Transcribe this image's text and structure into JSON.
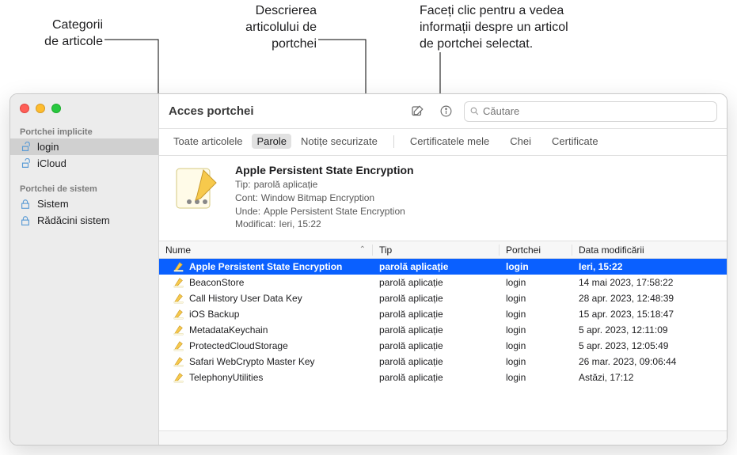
{
  "callouts": {
    "categories": "Categorii\nde articole",
    "description": "Descrierea\narticolului de\nportchei",
    "info": "Faceți clic pentru a vedea\ninformații despre un articol\nde portchei selectat."
  },
  "window_title": "Acces portchei",
  "search": {
    "placeholder": "Căutare"
  },
  "sidebar": {
    "section1_title": "Portchei implicite",
    "section2_title": "Portchei de sistem",
    "items1": [
      {
        "label": "login",
        "selected": true,
        "iconColor": "#5b9bd5",
        "unlocked": true
      },
      {
        "label": "iCloud",
        "selected": false,
        "iconColor": "#5b9bd5",
        "unlocked": true
      }
    ],
    "items2": [
      {
        "label": "Sistem",
        "selected": false,
        "iconColor": "#5b9bd5",
        "unlocked": false
      },
      {
        "label": "Rădăcini sistem",
        "selected": false,
        "iconColor": "#5b9bd5",
        "unlocked": false
      }
    ]
  },
  "tabs": {
    "groupA": [
      "Toate articolele",
      "Parole",
      "Notițe securizate"
    ],
    "selectedA": 1,
    "groupB": [
      "Certificatele mele",
      "Chei",
      "Certificate"
    ]
  },
  "detail": {
    "title": "Apple Persistent State Encryption",
    "fields": {
      "type_label": "Tip:",
      "type_value": "parolă aplicație",
      "account_label": "Cont:",
      "account_value": "Window Bitmap Encryption",
      "where_label": "Unde:",
      "where_value": "Apple Persistent State Encryption",
      "modified_label": "Modificat:",
      "modified_value": "Ieri, 15:22"
    }
  },
  "table": {
    "columns": {
      "name": "Nume",
      "type": "Tip",
      "keychain": "Portchei",
      "modified": "Data modificării"
    },
    "rows": [
      {
        "name": "Apple Persistent State Encryption",
        "type": "parolă aplicație",
        "keychain": "login",
        "modified": "Ieri, 15:22",
        "selected": true
      },
      {
        "name": "BeaconStore",
        "type": "parolă aplicație",
        "keychain": "login",
        "modified": "14 mai 2023, 17:58:22"
      },
      {
        "name": "Call History User Data Key",
        "type": "parolă aplicație",
        "keychain": "login",
        "modified": "28 apr. 2023, 12:48:39"
      },
      {
        "name": "iOS Backup",
        "type": "parolă aplicație",
        "keychain": "login",
        "modified": "15 apr. 2023, 15:18:47"
      },
      {
        "name": "MetadataKeychain",
        "type": "parolă aplicație",
        "keychain": "login",
        "modified": "5 apr. 2023, 12:11:09"
      },
      {
        "name": "ProtectedCloudStorage",
        "type": "parolă aplicație",
        "keychain": "login",
        "modified": "5 apr. 2023, 12:05:49"
      },
      {
        "name": "Safari WebCrypto Master Key",
        "type": "parolă aplicație",
        "keychain": "login",
        "modified": "26 mar. 2023, 09:06:44"
      },
      {
        "name": "TelephonyUtilities",
        "type": "parolă aplicație",
        "keychain": "login",
        "modified": "Astăzi, 17:12"
      }
    ]
  }
}
